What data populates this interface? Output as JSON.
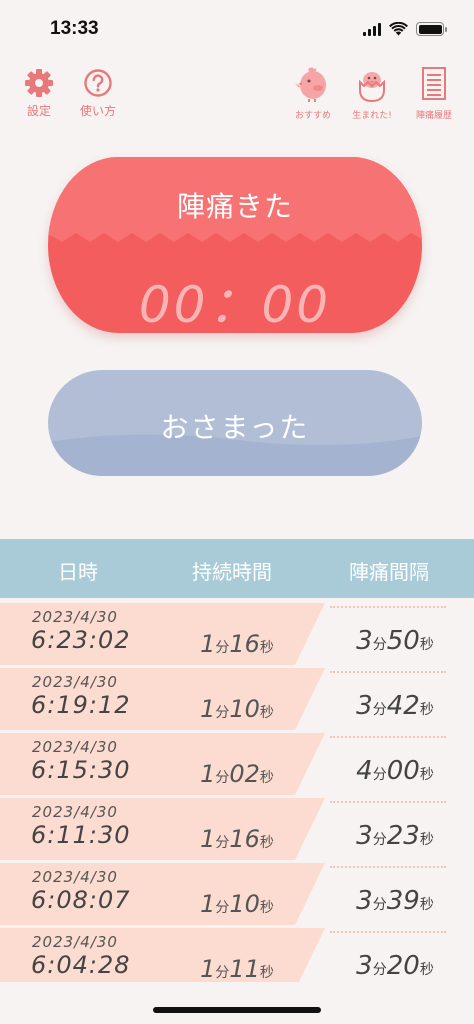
{
  "status_bar": {
    "time": "13:33"
  },
  "toolbar": {
    "settings_label": "設定",
    "howto_label": "使い方",
    "recommend_label": "おすすめ",
    "born_label": "生まれた!",
    "history_label": "陣痛履歴"
  },
  "contraction_button": {
    "label": "陣痛きた",
    "timer": "00：00"
  },
  "stop_button": {
    "label": "おさまった"
  },
  "table": {
    "headers": [
      "日時",
      "持続時間",
      "陣痛間隔"
    ],
    "rows": [
      {
        "date": "2023/4/30",
        "time": "6:23:02",
        "dur_min": "1",
        "dur_min_unit": "分",
        "dur_sec": "16",
        "dur_sec_unit": "秒",
        "int_min": "3",
        "int_min_unit": "分",
        "int_sec": "50",
        "int_sec_unit": "秒"
      },
      {
        "date": "2023/4/30",
        "time": "6:19:12",
        "dur_min": "1",
        "dur_min_unit": "分",
        "dur_sec": "10",
        "dur_sec_unit": "秒",
        "int_min": "3",
        "int_min_unit": "分",
        "int_sec": "42",
        "int_sec_unit": "秒"
      },
      {
        "date": "2023/4/30",
        "time": "6:15:30",
        "dur_min": "1",
        "dur_min_unit": "分",
        "dur_sec": "02",
        "dur_sec_unit": "秒",
        "int_min": "4",
        "int_min_unit": "分",
        "int_sec": "00",
        "int_sec_unit": "秒"
      },
      {
        "date": "2023/4/30",
        "time": "6:11:30",
        "dur_min": "1",
        "dur_min_unit": "分",
        "dur_sec": "16",
        "dur_sec_unit": "秒",
        "int_min": "3",
        "int_min_unit": "分",
        "int_sec": "23",
        "int_sec_unit": "秒"
      },
      {
        "date": "2023/4/30",
        "time": "6:08:07",
        "dur_min": "1",
        "dur_min_unit": "分",
        "dur_sec": "10",
        "dur_sec_unit": "秒",
        "int_min": "3",
        "int_min_unit": "分",
        "int_sec": "39",
        "int_sec_unit": "秒"
      },
      {
        "date": "2023/4/30",
        "time": "6:04:28",
        "dur_min": "1",
        "dur_min_unit": "分",
        "dur_sec": "11",
        "dur_sec_unit": "秒",
        "int_min": "3",
        "int_min_unit": "分",
        "int_sec": "20",
        "int_sec_unit": "秒"
      }
    ]
  },
  "icons": {
    "settings": "gear-icon",
    "howto": "question-circle-icon",
    "recommend": "chick-icon",
    "born": "hatching-egg-icon",
    "history": "document-list-icon",
    "signal": "cellular-signal-icon",
    "wifi": "wifi-icon",
    "battery": "battery-icon"
  },
  "colors": {
    "accent": "#e8797a",
    "contraction_button": "#f45d5d",
    "stop_button": "#b1bed6",
    "table_header": "#a9cbd8",
    "row_band": "#fcdcd0"
  }
}
